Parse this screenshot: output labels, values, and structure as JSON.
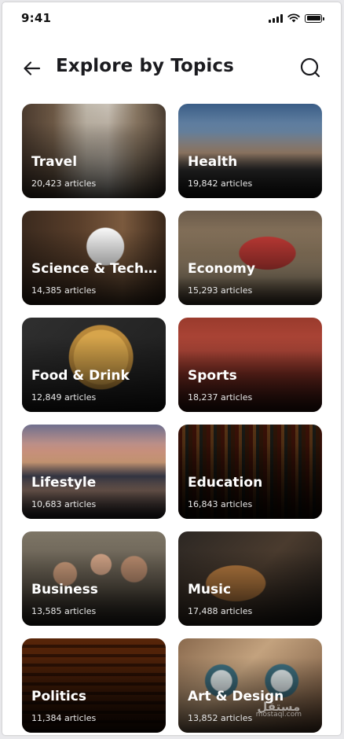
{
  "status_bar": {
    "time": "9:41"
  },
  "header": {
    "title": "Explore by Topics"
  },
  "topics": [
    {
      "title": "Travel",
      "count": "20,423 articles"
    },
    {
      "title": "Health",
      "count": "19,842 articles"
    },
    {
      "title": "Science & Techno...",
      "count": "14,385 articles"
    },
    {
      "title": "Economy",
      "count": "15,293 articles"
    },
    {
      "title": "Food & Drink",
      "count": "12,849 articles"
    },
    {
      "title": "Sports",
      "count": "18,237 articles"
    },
    {
      "title": "Lifestyle",
      "count": "10,683 articles"
    },
    {
      "title": "Education",
      "count": "16,843 articles"
    },
    {
      "title": "Business",
      "count": "13,585 articles"
    },
    {
      "title": "Music",
      "count": "17,488 articles"
    },
    {
      "title": "Politics",
      "count": "11,384 articles"
    },
    {
      "title": "Art & Design",
      "count": "13,852 articles"
    }
  ],
  "watermark": {
    "arabic": "مستقل",
    "latin": "mostaql.com"
  },
  "icons": {
    "back": "arrow-left-icon",
    "search": "search-icon",
    "signal": "signal-icon",
    "wifi": "wifi-icon",
    "battery": "battery-icon"
  }
}
